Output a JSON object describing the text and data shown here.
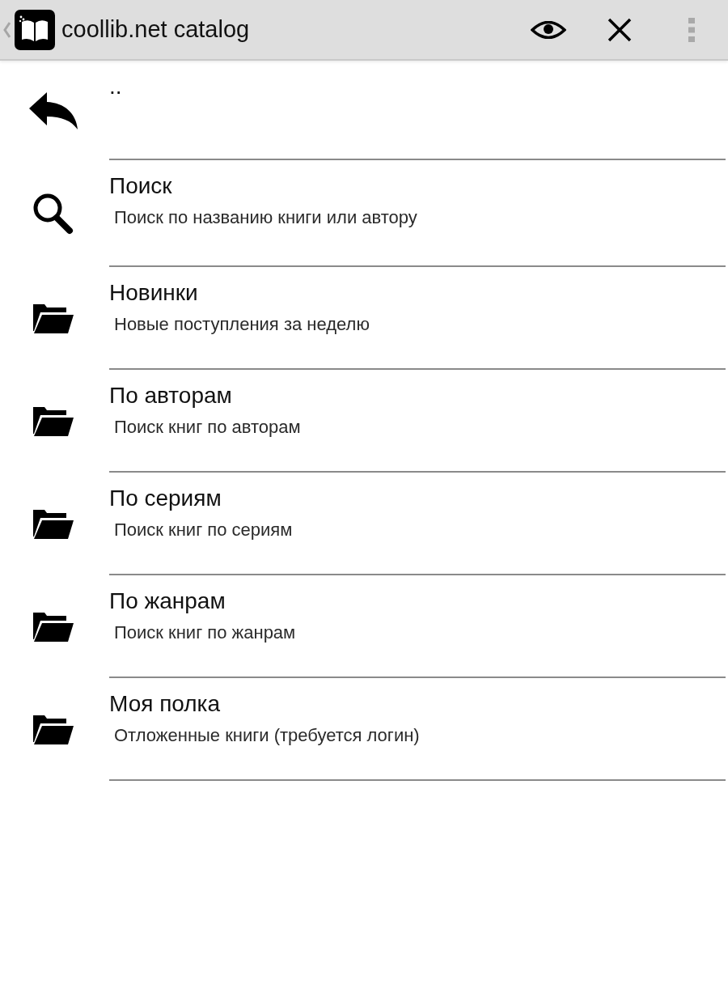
{
  "action_bar": {
    "title": "coollib.net catalog"
  },
  "entries": [
    {
      "kind": "parent",
      "title": ".."
    },
    {
      "kind": "search",
      "title": "Поиск",
      "subtitle": "Поиск по названию книги или автору"
    },
    {
      "kind": "folder",
      "title": "Новинки",
      "subtitle": "Новые поступления за неделю"
    },
    {
      "kind": "folder",
      "title": "По авторам",
      "subtitle": "Поиск книг по авторам"
    },
    {
      "kind": "folder",
      "title": "По сериям",
      "subtitle": "Поиск книг по сериям"
    },
    {
      "kind": "folder",
      "title": "По жанрам",
      "subtitle": "Поиск книг по жанрам"
    },
    {
      "kind": "folder",
      "title": "Моя полка",
      "subtitle": "Отложенные книги (требуется логин)"
    }
  ]
}
